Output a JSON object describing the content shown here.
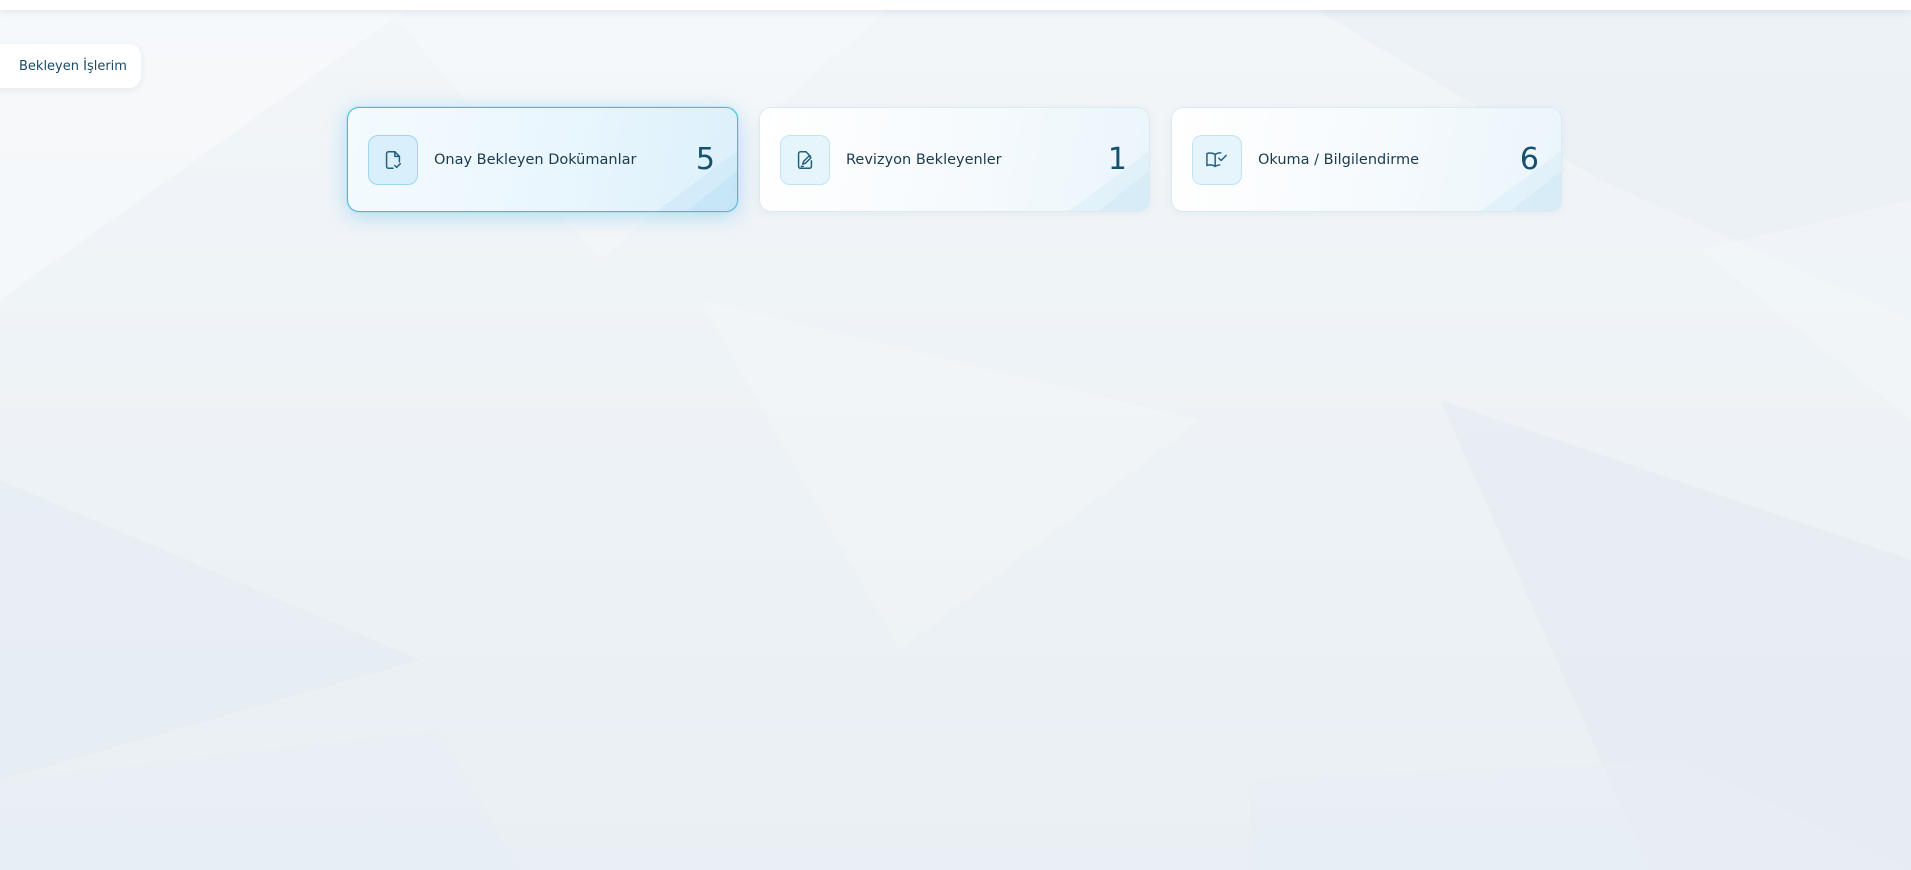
{
  "header": {
    "pending_label": "Bekleyen İşlerim"
  },
  "cards": [
    {
      "label": "Onay Bekleyen Dokümanlar",
      "count": "5",
      "icon": "document-check-icon",
      "active": true
    },
    {
      "label": "Revizyon Bekleyenler",
      "count": "1",
      "icon": "document-edit-icon",
      "active": false
    },
    {
      "label": "Okuma / Bilgilendirme",
      "count": "6",
      "icon": "book-check-icon",
      "active": false
    }
  ],
  "colors": {
    "accent": "#49b6e8",
    "text": "#1b3a4e",
    "count": "#16506f",
    "icon_stroke": "#1f5f80"
  }
}
